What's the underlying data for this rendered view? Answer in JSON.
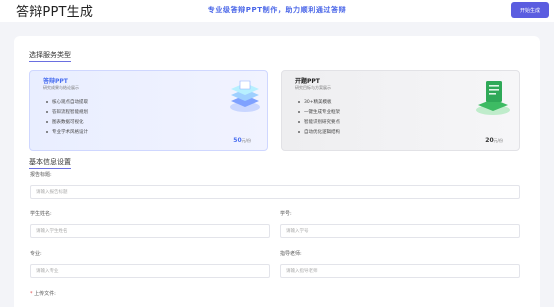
{
  "header": {
    "title": "答辩PPT生成",
    "tagline": "专业级答辩PPT制作，助力顺利通过答辩",
    "start_label": "开始生成"
  },
  "service_section": {
    "title": "选择服务类型",
    "options": [
      {
        "name": "答辩PPT",
        "subtitle": "研究成果与结论展示",
        "features": [
          "核心观点自动提取",
          "答辩流程智能规划",
          "图表数据可视化",
          "专业学术风格设计"
        ],
        "price": "50",
        "unit": "元/份",
        "selected": true,
        "icon": "layered-stack-illustration"
      },
      {
        "name": "开题PPT",
        "subtitle": "研究目标与方案展示",
        "features": [
          "30+精美模板",
          "一键生成专业框架",
          "智能识别研究要点",
          "自动优化逻辑结构"
        ],
        "price": "20",
        "unit": "元/份",
        "selected": false,
        "icon": "green-document-illustration"
      }
    ]
  },
  "basic_info": {
    "title": "基本信息设置",
    "report_title_label": "报告标题:",
    "report_title_placeholder": "请输入报告标题",
    "student_name_label": "学生姓名:",
    "student_name_placeholder": "请输入学生姓名",
    "student_id_label": "学号:",
    "student_id_placeholder": "请输入学号",
    "major_label": "专业:",
    "major_placeholder": "请输入专业",
    "advisor_label": "指导老师:",
    "advisor_placeholder": "请输入指导老师",
    "upload_required_mark": "*",
    "upload_label": "上传文件:"
  },
  "colors": {
    "accent": "#5b5de0",
    "selected_card": "#e9eeff",
    "tagline": "#4a66e8"
  }
}
